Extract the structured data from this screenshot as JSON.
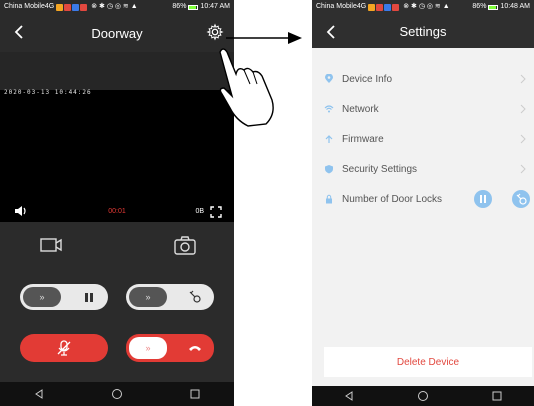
{
  "left_screen": {
    "status": {
      "carrier": "China Mobile4G",
      "battery": "86%",
      "time": "10:47 AM"
    },
    "title": "Doorway",
    "video": {
      "timestamp": "2020-03-13  10:44:26",
      "timer": "00:01",
      "data_rate": "0B"
    },
    "toggles": [
      {
        "name": "unlock-toggle-1",
        "knob": "»"
      },
      {
        "name": "unlock-toggle-2",
        "knob": "»"
      },
      {
        "name": "hangup-toggle",
        "knob": "»"
      }
    ]
  },
  "right_screen": {
    "status": {
      "carrier": "China Mobile4G",
      "battery": "86%",
      "time": "10:48 AM"
    },
    "title": "Settings",
    "items": [
      {
        "label": "Device Info",
        "icon": "location-pin-icon"
      },
      {
        "label": "Network",
        "icon": "wifi-icon"
      },
      {
        "label": "Firmware",
        "icon": "upload-arrow-icon"
      },
      {
        "label": "Security Settings",
        "icon": "shield-icon"
      },
      {
        "label": "Number of Door Locks",
        "icon": "lock-icon"
      }
    ],
    "delete_label": "Delete Device"
  },
  "colors": {
    "accent_red": "#e23b35",
    "settings_icon_blue": "#8fc3ee",
    "dark_bg": "#2b2b2b"
  }
}
